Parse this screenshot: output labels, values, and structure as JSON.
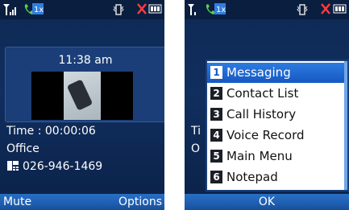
{
  "left_screen": {
    "call": {
      "time": "11:38 am",
      "duration": "Time : 00:00:06",
      "contact": "Office",
      "number": "026-946-1469"
    },
    "softkeys": {
      "left": "Mute",
      "right": "Options"
    }
  },
  "right_screen": {
    "menu_items": [
      {
        "num": "1",
        "label": "Messaging"
      },
      {
        "num": "2",
        "label": "Contact List"
      },
      {
        "num": "3",
        "label": "Call History"
      },
      {
        "num": "4",
        "label": "Voice Record"
      },
      {
        "num": "5",
        "label": "Main Menu"
      },
      {
        "num": "6",
        "label": "Notepad"
      }
    ],
    "selected_index": 0,
    "background_fragments": [
      "Ti",
      "O"
    ],
    "softkeys": {
      "center": "OK"
    }
  },
  "icons": [
    "signal-icon",
    "call-active-icon",
    "1x-icon",
    "vibrate-icon",
    "mute-icon",
    "battery-icon",
    "phone-number-icon"
  ],
  "colors": {
    "accent": "#1f5fb2",
    "highlight": "#1558c2",
    "background": "#0e2a55"
  }
}
